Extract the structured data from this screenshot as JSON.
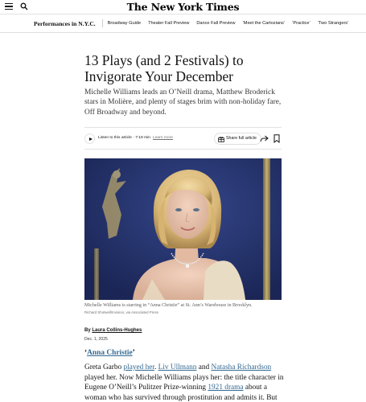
{
  "masthead": {
    "logo_text": "The New York Times"
  },
  "section_nav": {
    "title": "Performances in N.Y.C.",
    "items": [
      "Broadway Guide",
      "Theater Fall Preview",
      "Dance Fall Preview",
      "‘Meet the Cartozians’",
      "‘Practice’",
      "‘Two Strangers’"
    ]
  },
  "article": {
    "headline": "13 Plays (and 2 Festivals) to Invigorate Your December",
    "dek": "Michelle Williams leads an O’Neill drama, Matthew Broderick stars in Molière, and plenty of stages brim with non-holiday fare, Off Broadway and beyond.",
    "toolbar": {
      "listen_text": "Listen to this article · 7:19 min",
      "learn_more": "Learn more",
      "share_label": "Share full article"
    },
    "photo": {
      "caption": "Michelle Williams is starring in “Anna Christie” at St. Ann’s Warehouse in Brooklyn.",
      "credit": "Richard Shotwell/Invision, via Associated Press"
    },
    "byline_prefix": "By",
    "author": "Laura Collins-Hughes",
    "date": "Dec. 1, 2025",
    "subhead": {
      "open_quote": "‘",
      "link_text": "Anna Christie",
      "close_quote": "’"
    },
    "body": {
      "t1": "Greta Garbo ",
      "l1": "played her",
      "t2": ". ",
      "l2": "Liv Ullmann",
      "t3": " and ",
      "l3": "Natasha Richardson",
      "t4": " played her. Now Michelle Williams plays her: the title character in Eugene O’Neill’s Pulitzer Prize-winning ",
      "l4": "1921 drama",
      "t5": " about a woman who has survived through prostitution and admits it. But for the"
    }
  },
  "colors": {
    "link": "#326891",
    "text": "#121212",
    "photo_backdrop": "#23336a"
  }
}
